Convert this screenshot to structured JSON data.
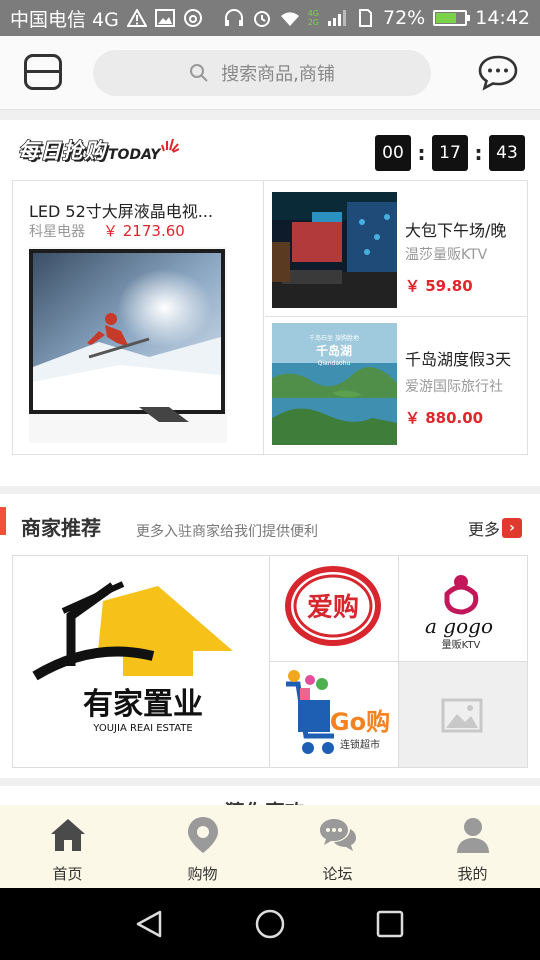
{
  "status_bar": {
    "carrier": "中国电信 4G",
    "signal_label_top": "4G",
    "signal_label_bottom": "2G",
    "battery": "72%",
    "battery_level": 0.72,
    "time": "14:42"
  },
  "header": {
    "search_placeholder": "搜索商品,商铺"
  },
  "flash_sale": {
    "title_cn": "每日抢购",
    "title_en": "TODAY",
    "countdown": {
      "hours": "00",
      "minutes": "17",
      "seconds": "43"
    },
    "main_deal": {
      "name": "LED 52寸大屏液晶电视...",
      "store": "科星电器",
      "price": "￥ 2173.60"
    },
    "side_deals": [
      {
        "name": "大包下午场/晚",
        "store": "温莎量贩KTV",
        "price": "￥ 59.80"
      },
      {
        "name": "千岛湖度假3天",
        "store": "爱游国际旅行社",
        "price": "￥ 880.00"
      }
    ],
    "side_images": [
      {
        "caption_top": "",
        "caption_main": "",
        "caption_sub": ""
      },
      {
        "caption_top": "千岛石坐 旅购胜地",
        "caption_main": "千岛湖",
        "caption_sub": "Qiandaohu"
      }
    ]
  },
  "merchants": {
    "title": "商家推荐",
    "subtitle": "更多入驻商家给我们提供便利",
    "more": "更多",
    "tiles": {
      "big": {
        "name": "有家置业",
        "sub": "YOUJIA REAI ESTATE"
      },
      "c1": {
        "name": "爱购"
      },
      "c2": {
        "name": "a gogo",
        "sub": "量贩KTV"
      },
      "c3": {
        "name": "Go购",
        "sub": "连锁超市"
      }
    }
  },
  "next_section": {
    "title": "猜你喜欢"
  },
  "tabbar": [
    {
      "label": "首页",
      "icon": "home-icon"
    },
    {
      "label": "购物",
      "icon": "location-pin-icon"
    },
    {
      "label": "论坛",
      "icon": "chat-bubbles-icon"
    },
    {
      "label": "我的",
      "icon": "user-icon"
    }
  ],
  "colors": {
    "price_red": "#e0262b",
    "accent_orange": "#f0503c",
    "tab_bg": "#fcf8e7",
    "status_bg": "#7c7c7c"
  }
}
